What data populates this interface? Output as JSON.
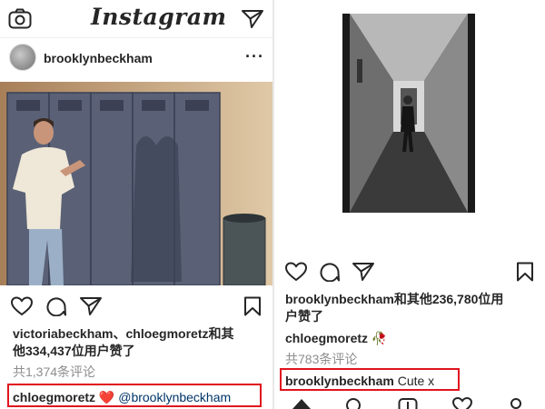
{
  "left": {
    "app_title": "Instagram",
    "icons": {
      "camera": "camera-icon",
      "direct": "paper-plane-icon",
      "more": "more-icon",
      "like": "heart-icon",
      "comment": "comment-icon",
      "share": "paper-plane-icon",
      "save": "bookmark-icon"
    },
    "post": {
      "username": "brooklynbeckham",
      "more_label": "···",
      "likes_line1": "victoriabeckham、chloegmoretz和其",
      "likes_line2": "他334,437位用户赞了",
      "comments_link": "共1,374条评论",
      "comment_user": "chloegmoretz",
      "comment_emoji": "❤️",
      "comment_mention": "@brooklynbeckham"
    }
  },
  "right": {
    "post": {
      "likes_line1": "brooklynbeckham和其他236,780位用",
      "likes_line2": "户赞了",
      "caption_user": "chloegmoretz",
      "caption_emoji": "🥀",
      "comments_link": "共783条评论",
      "comment_user": "brooklynbeckham",
      "comment_text": "Cute x"
    },
    "nav": [
      "home-icon",
      "search-icon",
      "add-post-icon",
      "heart-icon",
      "profile-icon"
    ]
  },
  "colors": {
    "highlight_box": "#e0141e",
    "heart_red": "#e0141e",
    "text": "#262626",
    "muted_text": "#8e8e8e",
    "mention": "#003569"
  }
}
